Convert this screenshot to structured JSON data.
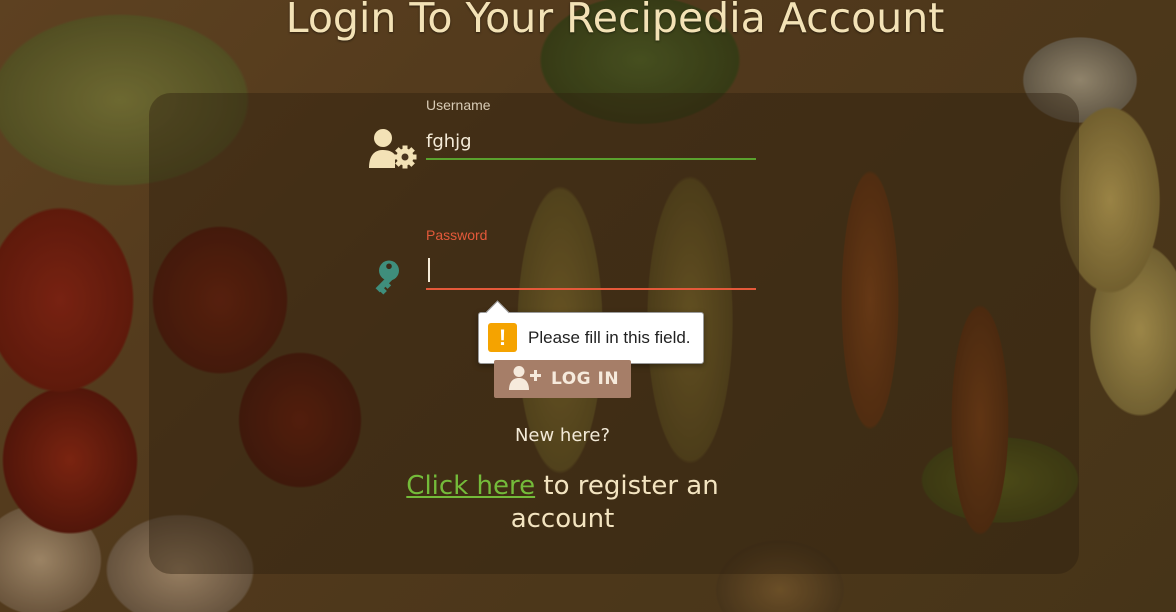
{
  "page": {
    "title": "Login To Your Recipedia Account"
  },
  "form": {
    "username": {
      "label": "Username",
      "value": "fghjg",
      "icon": "user-gear-icon"
    },
    "password": {
      "label": "Password",
      "value": "",
      "icon": "key-icon"
    },
    "validation_message": "Please fill in this field.",
    "login_button_label": "LOG IN",
    "login_button_icon": "user-plus-icon"
  },
  "register": {
    "prompt": "New here?",
    "link_text": "Click here",
    "suffix_text": " to register an account"
  },
  "colors": {
    "title": "#f3e2b6",
    "username_underline": "#5aa12e",
    "password_underline": "#e4593a",
    "button_bg": "#a67e68",
    "link": "#74bb3a",
    "warning": "#f5a300"
  }
}
